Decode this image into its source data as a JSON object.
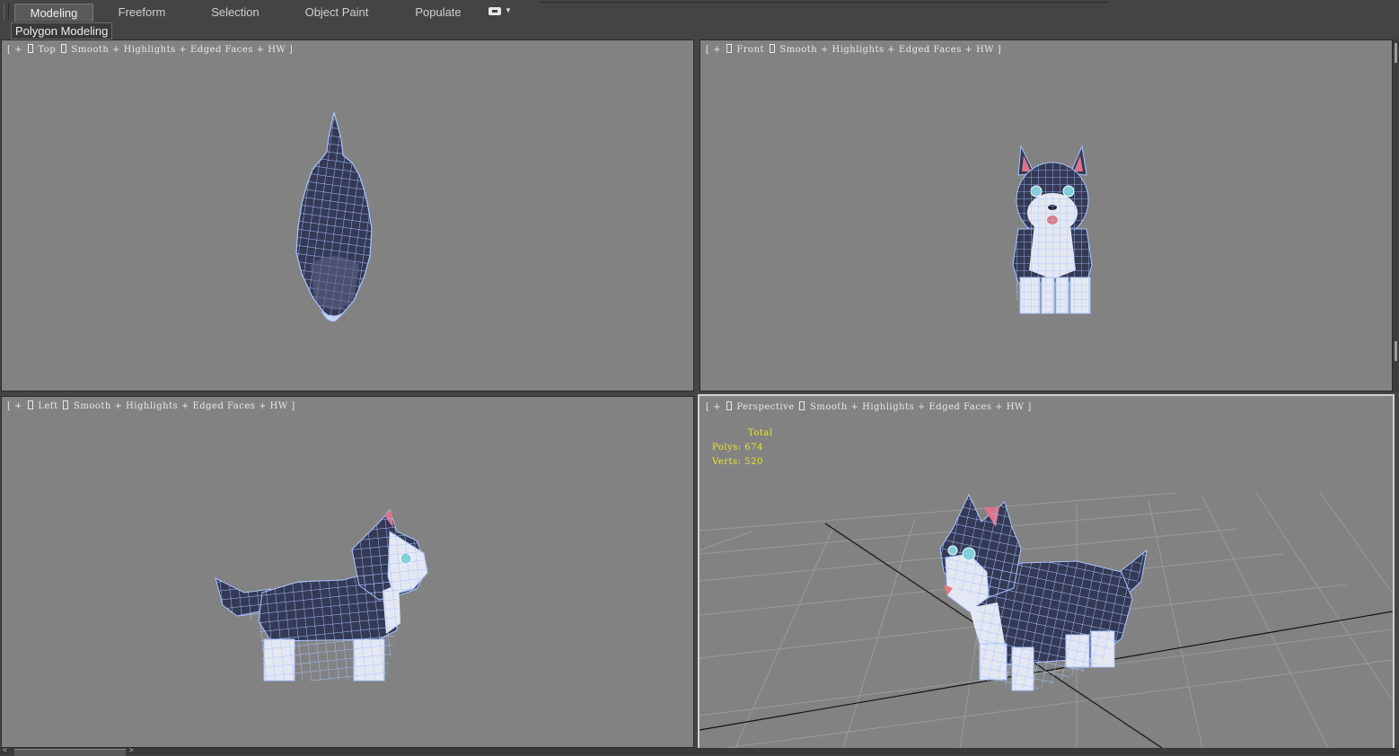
{
  "ribbon": {
    "tabs": [
      {
        "label": "Modeling",
        "active": true
      },
      {
        "label": "Freeform",
        "active": false
      },
      {
        "label": "Selection",
        "active": false
      },
      {
        "label": "Object Paint",
        "active": false
      },
      {
        "label": "Populate",
        "active": false
      }
    ],
    "toggle_icon": "ribbon-toggle-icon",
    "panel_label": "Polygon Modeling"
  },
  "viewports": [
    {
      "view": "Top",
      "shading": "Smooth + Highlights + Edged Faces + HW ]"
    },
    {
      "view": "Front",
      "shading": "Smooth + Highlights + Edged Faces + HW ]"
    },
    {
      "view": "Left",
      "shading": "Smooth + Highlights + Edged Faces + HW ]"
    },
    {
      "view": "Perspective",
      "shading": "Smooth + Highlights + Edged Faces + HW ]"
    }
  ],
  "label_prefix": "[ + ]",
  "stats": {
    "title": "Total",
    "polys_label": "Polys:",
    "polys_value": "674",
    "verts_label": "Verts:",
    "verts_value": "520"
  },
  "colors": {
    "viewport_bg": "#828282",
    "wire": "#a9c3ff",
    "fur_dark": "#343a55",
    "fur_light": "#e4e8f2",
    "stats_text": "#e6e62c"
  }
}
